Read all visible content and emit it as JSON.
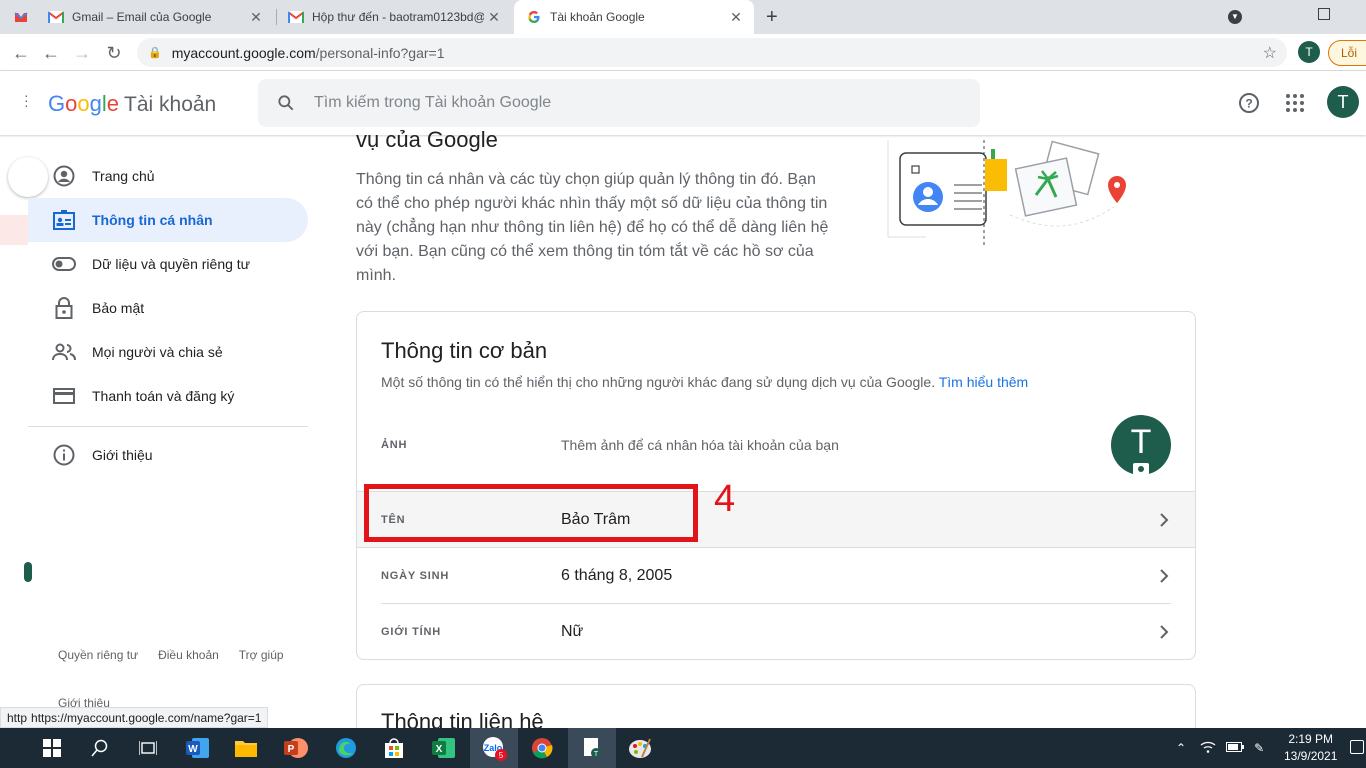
{
  "browser": {
    "tabs": [
      {
        "label": "Gmail – Email của Google",
        "icon": "gmail-icon"
      },
      {
        "label": "Hộp thư đến - baotram0123bd@",
        "icon": "gmail-icon"
      },
      {
        "label": "Tài khoản Google",
        "icon": "google-g-icon"
      }
    ],
    "new_tab_label": "+",
    "url_host": "myaccount.google.com",
    "url_path": "/personal-info?gar=1",
    "profile_initial": "T",
    "error_label": "Lỗi"
  },
  "header": {
    "logo": [
      "G",
      "o",
      "o",
      "g",
      "l",
      "e"
    ],
    "logo_colors": [
      "#4285f4",
      "#ea4335",
      "#fbbc05",
      "#4285f4",
      "#34a853",
      "#ea4335"
    ],
    "product": "Tài khoản",
    "search_placeholder": "Tìm kiếm trong Tài khoản Google",
    "avatar_initial": "T"
  },
  "sidebar": {
    "items": [
      {
        "label": "Trang chủ",
        "icon": "account-circle-icon"
      },
      {
        "label": "Thông tin cá nhân",
        "icon": "id-card-icon",
        "active": true
      },
      {
        "label": "Dữ liệu và quyền riêng tư",
        "icon": "toggle-icon"
      },
      {
        "label": "Bảo mật",
        "icon": "lock-icon"
      },
      {
        "label": "Mọi người và chia sẻ",
        "icon": "people-icon"
      },
      {
        "label": "Thanh toán và đăng ký",
        "icon": "credit-card-icon"
      }
    ],
    "about": {
      "label": "Giới thiệu",
      "icon": "info-icon"
    },
    "footer": [
      "Quyền riêng tư",
      "Điều khoản",
      "Trợ giúp"
    ],
    "footer_extra": "Giới thiệu"
  },
  "main": {
    "intro_heading": "vụ của Google",
    "intro_text": "Thông tin cá nhân và các tùy chọn giúp quản lý thông tin đó. Bạn có thể cho phép người khác nhìn thấy một số dữ liệu của thông tin này (chẳng hạn như thông tin liên hệ) để họ có thể dễ dàng liên hệ với bạn. Bạn cũng có thể xem thông tin tóm tắt về các hồ sơ của mình.",
    "basic_card": {
      "title": "Thông tin cơ bản",
      "subtitle": "Một số thông tin có thể hiển thị cho những người khác đang sử dụng dịch vụ của Google.",
      "learn_more": "Tìm hiểu thêm",
      "photo_label": "ẢNH",
      "photo_hint": "Thêm ảnh để cá nhân hóa tài khoản của bạn",
      "photo_initial": "T",
      "rows": [
        {
          "label": "TÊN",
          "value": "Bảo Trâm"
        },
        {
          "label": "NGÀY SINH",
          "value": "6 tháng 8, 2005"
        },
        {
          "label": "GIỚI TÍNH",
          "value": "Nữ"
        }
      ]
    },
    "contact_card": {
      "title": "Thông tin liên hệ"
    },
    "annotation_number": "4"
  },
  "status_url": "https://myaccount.google.com/name?gar=1",
  "status_prefix": "http",
  "taskbar": {
    "time": "2:19 PM",
    "date": "13/9/2021",
    "zalo_badge": "5"
  }
}
